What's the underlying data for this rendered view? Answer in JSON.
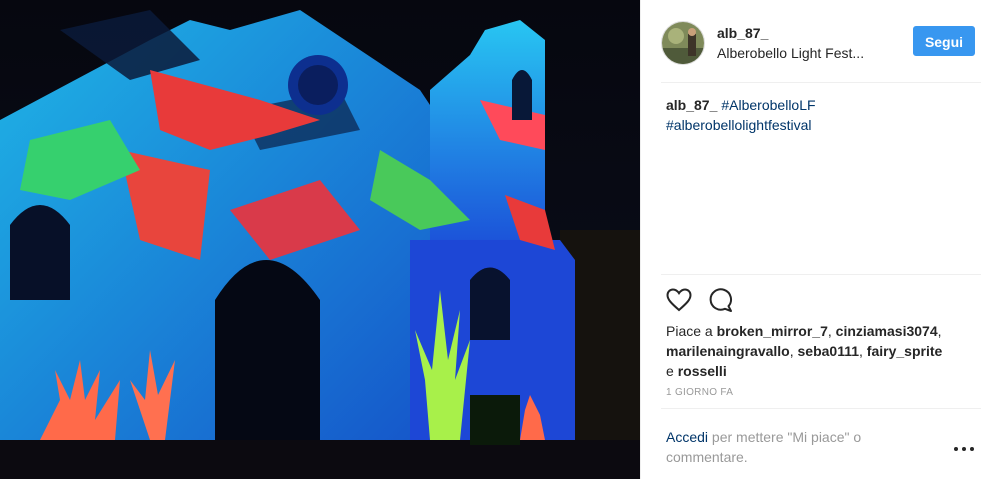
{
  "post": {
    "username": "alb_87_",
    "location": "Alberobello Light Fest...",
    "follow_label": "Segui"
  },
  "caption": {
    "username": "alb_87_",
    "hashtags": [
      "#AlberobelloLF",
      "#alberobellolightfestival"
    ]
  },
  "likes": {
    "prefix": "Piace a ",
    "users": [
      "broken_mirror_7",
      "cinziamasi3074",
      "marilenaingravallo",
      "seba0111",
      "fairy_sprite"
    ],
    "separator": ", ",
    "conjunction": " e ",
    "last_user": "rosselli"
  },
  "timestamp": "1 GIORNO FA",
  "comment_prompt": {
    "login_link": "Accedi",
    "rest": " per mettere \"Mi piace\" o commentare."
  },
  "icons": {
    "like": "heart-icon",
    "comment": "speech-bubble-icon",
    "more": "more-options-icon"
  },
  "colors": {
    "follow_button": "#3897f0",
    "hashtag": "#003569",
    "muted": "#999999"
  }
}
